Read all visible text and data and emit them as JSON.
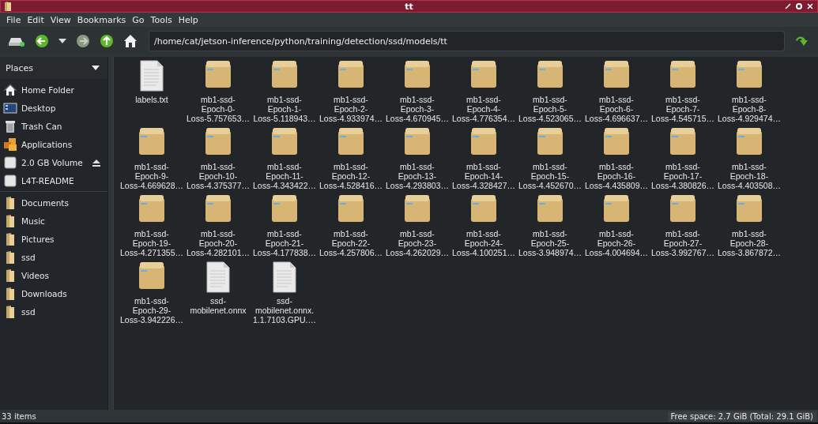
{
  "window": {
    "title": "tt"
  },
  "menu": [
    "File",
    "Edit",
    "View",
    "Bookmarks",
    "Go",
    "Tools",
    "Help"
  ],
  "location": {
    "value": "/home/cat/jetson-inference/python/training/detection/ssd/models/tt"
  },
  "sidebar": {
    "title": "Places",
    "items": [
      {
        "label": "Home Folder",
        "kind": "home",
        "eject": false
      },
      {
        "label": "Desktop",
        "kind": "desktop",
        "eject": false
      },
      {
        "label": "Trash Can",
        "kind": "trash",
        "eject": false
      },
      {
        "label": "Applications",
        "kind": "apps",
        "eject": false
      },
      {
        "label": "2.0 GB Volume",
        "kind": "drive",
        "eject": true
      },
      {
        "label": "L4T-README",
        "kind": "drive",
        "eject": false
      },
      {
        "label": "Documents",
        "kind": "folder",
        "eject": false
      },
      {
        "label": "Music",
        "kind": "folder",
        "eject": false
      },
      {
        "label": "Pictures",
        "kind": "folder",
        "eject": false
      },
      {
        "label": "ssd",
        "kind": "folder",
        "eject": false
      },
      {
        "label": "Videos",
        "kind": "folder",
        "eject": false
      },
      {
        "label": "Downloads",
        "kind": "folder",
        "eject": false
      },
      {
        "label": "ssd",
        "kind": "folder",
        "eject": false
      }
    ]
  },
  "files": [
    {
      "kind": "text",
      "name": [
        "labels.txt"
      ]
    },
    {
      "kind": "archive",
      "name": [
        "mb1-ssd-",
        "Epoch-0-",
        "Loss-5.757653…"
      ]
    },
    {
      "kind": "archive",
      "name": [
        "mb1-ssd-",
        "Epoch-1-",
        "Loss-5.118943…"
      ]
    },
    {
      "kind": "archive",
      "name": [
        "mb1-ssd-",
        "Epoch-2-",
        "Loss-4.933974…"
      ]
    },
    {
      "kind": "archive",
      "name": [
        "mb1-ssd-",
        "Epoch-3-",
        "Loss-4.670945…"
      ]
    },
    {
      "kind": "archive",
      "name": [
        "mb1-ssd-",
        "Epoch-4-",
        "Loss-4.776354…"
      ]
    },
    {
      "kind": "archive",
      "name": [
        "mb1-ssd-",
        "Epoch-5-",
        "Loss-4.523065…"
      ]
    },
    {
      "kind": "archive",
      "name": [
        "mb1-ssd-",
        "Epoch-6-",
        "Loss-4.696637…"
      ]
    },
    {
      "kind": "archive",
      "name": [
        "mb1-ssd-",
        "Epoch-7-",
        "Loss-4.545715…"
      ]
    },
    {
      "kind": "archive",
      "name": [
        "mb1-ssd-",
        "Epoch-8-",
        "Loss-4.929474…"
      ]
    },
    {
      "kind": "archive",
      "name": [
        "mb1-ssd-",
        "Epoch-9-",
        "Loss-4.669628…"
      ]
    },
    {
      "kind": "archive",
      "name": [
        "mb1-ssd-",
        "Epoch-10-",
        "Loss-4.375377…"
      ]
    },
    {
      "kind": "archive",
      "name": [
        "mb1-ssd-",
        "Epoch-11-",
        "Loss-4.343422…"
      ]
    },
    {
      "kind": "archive",
      "name": [
        "mb1-ssd-",
        "Epoch-12-",
        "Loss-4.528416…"
      ]
    },
    {
      "kind": "archive",
      "name": [
        "mb1-ssd-",
        "Epoch-13-",
        "Loss-4.293803…"
      ]
    },
    {
      "kind": "archive",
      "name": [
        "mb1-ssd-",
        "Epoch-14-",
        "Loss-4.328427…"
      ]
    },
    {
      "kind": "archive",
      "name": [
        "mb1-ssd-",
        "Epoch-15-",
        "Loss-4.452670…"
      ]
    },
    {
      "kind": "archive",
      "name": [
        "mb1-ssd-",
        "Epoch-16-",
        "Loss-4.435809…"
      ]
    },
    {
      "kind": "archive",
      "name": [
        "mb1-ssd-",
        "Epoch-17-",
        "Loss-4.380826…"
      ]
    },
    {
      "kind": "archive",
      "name": [
        "mb1-ssd-",
        "Epoch-18-",
        "Loss-4.403508…"
      ]
    },
    {
      "kind": "archive",
      "name": [
        "mb1-ssd-",
        "Epoch-19-",
        "Loss-4.271355…"
      ]
    },
    {
      "kind": "archive",
      "name": [
        "mb1-ssd-",
        "Epoch-20-",
        "Loss-4.282101…"
      ]
    },
    {
      "kind": "archive",
      "name": [
        "mb1-ssd-",
        "Epoch-21-",
        "Loss-4.177838…"
      ]
    },
    {
      "kind": "archive",
      "name": [
        "mb1-ssd-",
        "Epoch-22-",
        "Loss-4.257806…"
      ]
    },
    {
      "kind": "archive",
      "name": [
        "mb1-ssd-",
        "Epoch-23-",
        "Loss-4.262029…"
      ]
    },
    {
      "kind": "archive",
      "name": [
        "mb1-ssd-",
        "Epoch-24-",
        "Loss-4.100251…"
      ]
    },
    {
      "kind": "archive",
      "name": [
        "mb1-ssd-",
        "Epoch-25-",
        "Loss-3.948974…"
      ]
    },
    {
      "kind": "archive",
      "name": [
        "mb1-ssd-",
        "Epoch-26-",
        "Loss-4.004694…"
      ]
    },
    {
      "kind": "archive",
      "name": [
        "mb1-ssd-",
        "Epoch-27-",
        "Loss-3.992767…"
      ]
    },
    {
      "kind": "archive",
      "name": [
        "mb1-ssd-",
        "Epoch-28-",
        "Loss-3.867872…"
      ]
    },
    {
      "kind": "archive",
      "name": [
        "mb1-ssd-",
        "Epoch-29-",
        "Loss-3.942226…"
      ]
    },
    {
      "kind": "text",
      "name": [
        "ssd-",
        "mobilenet.onnx"
      ]
    },
    {
      "kind": "text",
      "name": [
        "ssd-",
        "mobilenet.onnx.",
        "1.1.7103.GPU.…"
      ]
    }
  ],
  "status_bar": {
    "count": "33 items",
    "free_space": "Free space: 2.7 GiB (Total: 29.1 GiB)"
  }
}
